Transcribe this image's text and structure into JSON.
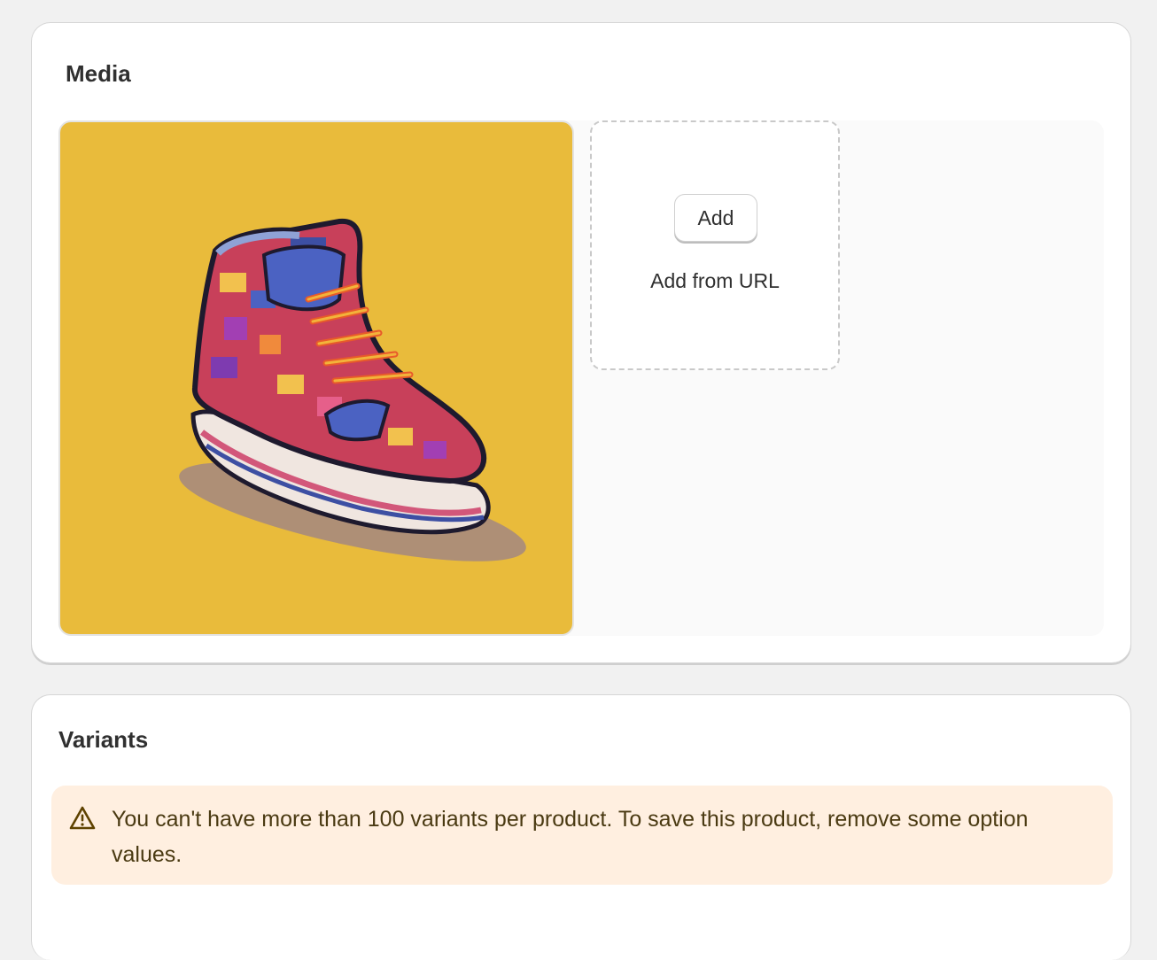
{
  "media": {
    "title": "Media",
    "image": {
      "alt_icon": "sneaker-image",
      "background_color": "#e9bb3b"
    },
    "dropzone": {
      "add_label": "Add",
      "add_from_url_label": "Add from URL"
    }
  },
  "variants": {
    "title": "Variants",
    "banner": {
      "icon": "warning-icon",
      "message": "You can't have more than 100 variants per product. To save this product, remove some option values.",
      "background_color": "#ffefe0"
    }
  }
}
